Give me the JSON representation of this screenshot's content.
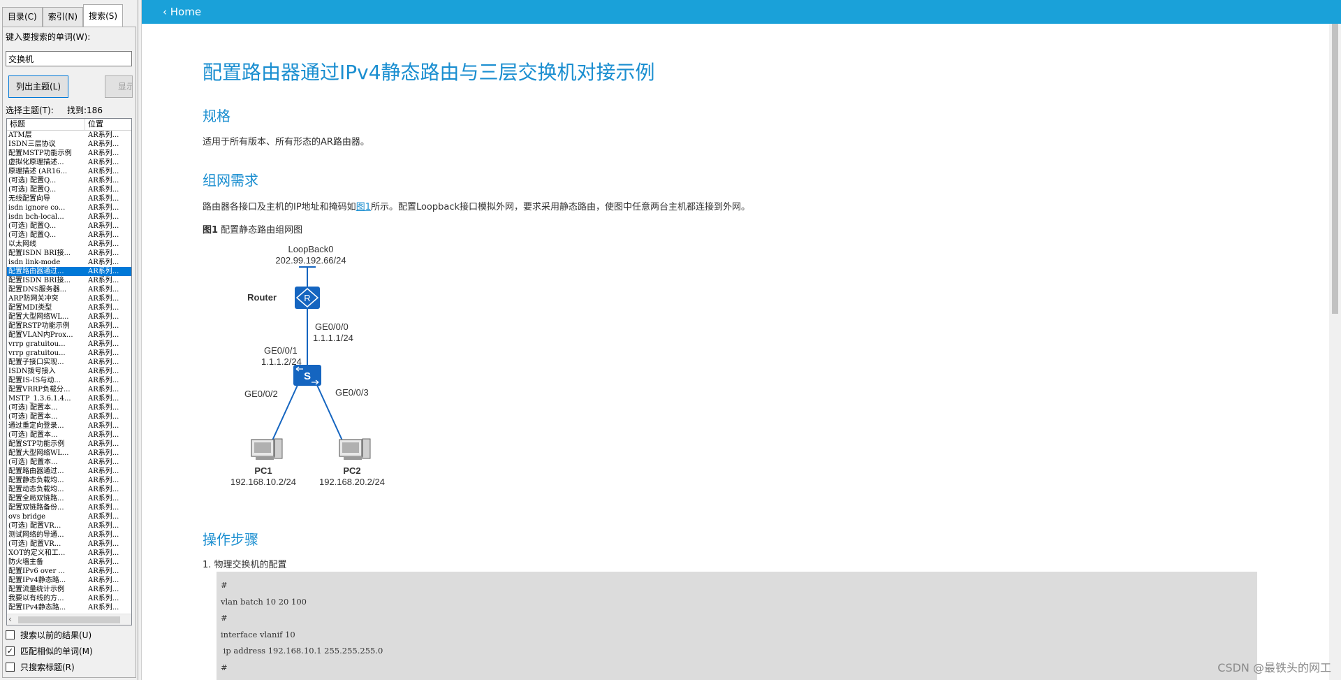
{
  "sidebar": {
    "tabs": [
      {
        "label": "目录(C)"
      },
      {
        "label": "索引(N)"
      },
      {
        "label": "搜索(S)",
        "active": true
      }
    ],
    "keyword_label": "键入要搜索的单词(W):",
    "search_value": "交换机",
    "list_button": "列出主题(L)",
    "show_button": "显示",
    "select_label": "选择主题(T):",
    "found_label": "找到:186",
    "columns": {
      "title": "标题",
      "position": "位置"
    },
    "topics": [
      {
        "title": "ATM层",
        "pos": "AR系列..."
      },
      {
        "title": "ISDN三层协议",
        "pos": "AR系列..."
      },
      {
        "title": "配置MSTP功能示例",
        "pos": "AR系列..."
      },
      {
        "title": "虚拟化原理描述...",
        "pos": "AR系列..."
      },
      {
        "title": "原理描述 (AR16...",
        "pos": "AR系列..."
      },
      {
        "title": "(可选) 配置Q...",
        "pos": "AR系列..."
      },
      {
        "title": "(可选) 配置Q...",
        "pos": "AR系列..."
      },
      {
        "title": "无线配置向导",
        "pos": "AR系列..."
      },
      {
        "title": "isdn ignore co...",
        "pos": "AR系列..."
      },
      {
        "title": "isdn bch-local...",
        "pos": "AR系列..."
      },
      {
        "title": "(可选) 配置Q...",
        "pos": "AR系列..."
      },
      {
        "title": "(可选) 配置Q...",
        "pos": "AR系列..."
      },
      {
        "title": "以太网线",
        "pos": "AR系列..."
      },
      {
        "title": "配置ISDN BRI接...",
        "pos": "AR系列..."
      },
      {
        "title": "isdn link-mode",
        "pos": "AR系列..."
      },
      {
        "title": "配置路由器通过...",
        "pos": "AR系列...",
        "selected": true
      },
      {
        "title": "配置ISDN BRI接...",
        "pos": "AR系列..."
      },
      {
        "title": "配置DNS服务器...",
        "pos": "AR系列..."
      },
      {
        "title": "ARP防网关冲突",
        "pos": "AR系列..."
      },
      {
        "title": "配置MDI类型",
        "pos": "AR系列..."
      },
      {
        "title": "配置大型网络WL...",
        "pos": "AR系列..."
      },
      {
        "title": "配置RSTP功能示例",
        "pos": "AR系列..."
      },
      {
        "title": "配置VLAN内Prox...",
        "pos": "AR系列..."
      },
      {
        "title": "vrrp gratuitou...",
        "pos": "AR系列..."
      },
      {
        "title": "vrrp gratuitou...",
        "pos": "AR系列..."
      },
      {
        "title": "配置子接口实现...",
        "pos": "AR系列..."
      },
      {
        "title": "ISDN拨号接入",
        "pos": "AR系列..."
      },
      {
        "title": "配置IS-IS与动...",
        "pos": "AR系列..."
      },
      {
        "title": "配置VRRP负载分...",
        "pos": "AR系列..."
      },
      {
        "title": "MSTP_1.3.6.1.4...",
        "pos": "AR系列..."
      },
      {
        "title": "(可选) 配置本...",
        "pos": "AR系列..."
      },
      {
        "title": "(可选) 配置本...",
        "pos": "AR系列..."
      },
      {
        "title": "通过重定向登录...",
        "pos": "AR系列..."
      },
      {
        "title": "(可选) 配置本...",
        "pos": "AR系列..."
      },
      {
        "title": "配置STP功能示例",
        "pos": "AR系列..."
      },
      {
        "title": "配置大型网络WL...",
        "pos": "AR系列..."
      },
      {
        "title": "(可选) 配置本...",
        "pos": "AR系列..."
      },
      {
        "title": "配置路由器通过...",
        "pos": "AR系列..."
      },
      {
        "title": "配置静态负载均...",
        "pos": "AR系列..."
      },
      {
        "title": "配置动态负载均...",
        "pos": "AR系列..."
      },
      {
        "title": "配置全局双链路...",
        "pos": "AR系列..."
      },
      {
        "title": "配置双链路备份...",
        "pos": "AR系列..."
      },
      {
        "title": "ovs bridge",
        "pos": "AR系列..."
      },
      {
        "title": "(可选) 配置VR...",
        "pos": "AR系列..."
      },
      {
        "title": "测试网络的导通...",
        "pos": "AR系列..."
      },
      {
        "title": "(可选) 配置VR...",
        "pos": "AR系列..."
      },
      {
        "title": "XOT的定义和工...",
        "pos": "AR系列..."
      },
      {
        "title": "防火墙主备",
        "pos": "AR系列..."
      },
      {
        "title": "配置IPv6 over ...",
        "pos": "AR系列..."
      },
      {
        "title": "配置IPv4静态路...",
        "pos": "AR系列..."
      },
      {
        "title": "配置流量统计示例",
        "pos": "AR系列..."
      },
      {
        "title": "我要以有线的方...",
        "pos": "AR系列..."
      },
      {
        "title": "配置IPv4静态路...",
        "pos": "AR系列..."
      }
    ],
    "checkboxes": [
      {
        "label": "搜索以前的结果(U)",
        "checked": false
      },
      {
        "label": "匹配相似的单词(M)",
        "checked": true
      },
      {
        "label": "只搜索标题(R)",
        "checked": false
      }
    ]
  },
  "topbar": {
    "home_label": "Home",
    "color": "#1aa1d9"
  },
  "doc": {
    "title": "配置路由器通过IPv4静态路由与三层交换机对接示例",
    "sec_spec": "规格",
    "spec_text": "适用于所有版本、所有形态的AR路由器。",
    "sec_req": "组网需求",
    "req_text_before": "路由器各接口及主机的IP地址和掩码如",
    "req_link": "图1",
    "req_text_after": "所示。配置Loopback接口模拟外网，要求采用静态路由，使图中任意两台主机都连接到外网。",
    "fig_num": "图1",
    "fig_caption": " 配置静态路由组网图",
    "sec_steps": "操作步骤",
    "step1": "1.  物理交换机的配置",
    "code_lines": [
      "#",
      "vlan batch 10 20 100",
      "#",
      "interface vlanif 10",
      " ip address 192.168.10.1 255.255.255.0",
      "#"
    ]
  },
  "topology": {
    "loopback_name": "LoopBack0",
    "loopback_ip": "202.99.192.66/24",
    "router_label": "Router",
    "router_icon_text": "R",
    "router_if": "GE0/0/0",
    "router_ip": "1.1.1.1/24",
    "switch_if_up": "GE0/0/1",
    "switch_ip_up": "1.1.1.2/24",
    "switch_icon_text": "S",
    "switch_if_left": "GE0/0/2",
    "switch_if_right": "GE0/0/3",
    "pc1_name": "PC1",
    "pc1_ip": "192.168.10.2/24",
    "pc2_name": "PC2",
    "pc2_ip": "192.168.20.2/24",
    "device_color": "#1565c0"
  },
  "watermark": "CSDN @最铁头的网工"
}
